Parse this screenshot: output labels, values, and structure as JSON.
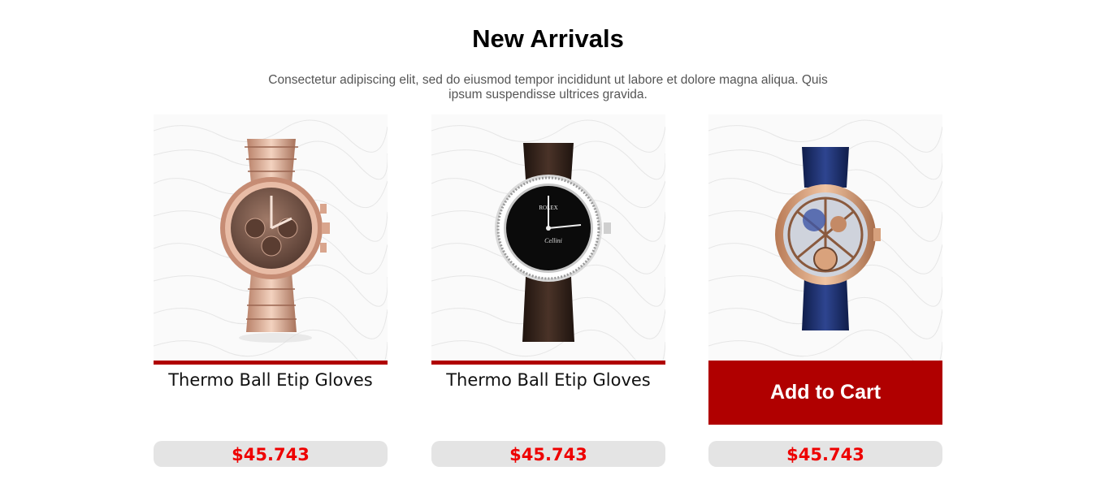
{
  "section": {
    "title": "New Arrivals",
    "subtitle": "Consectetur adipiscing elit, sed do eiusmod tempor incididunt ut labore et dolore magna aliqua. Quis ipsum suspendisse ultrices gravida."
  },
  "products": [
    {
      "name": "Thermo Ball Etip Gloves",
      "price": "$45.743",
      "image": "rose-gold-chronograph-watch-image"
    },
    {
      "name": "Thermo Ball Etip Gloves",
      "price": "$45.743",
      "image": "black-dial-leather-watch-image",
      "dial_brand": "ROLEX",
      "dial_model": "Cellini"
    },
    {
      "price": "$45.743",
      "image": "skeleton-tourbillon-watch-image",
      "cta_label": "Add to Cart"
    }
  ],
  "colors": {
    "accent": "#b00000",
    "price": "#ee0000",
    "price_bg": "#e4e4e4"
  }
}
